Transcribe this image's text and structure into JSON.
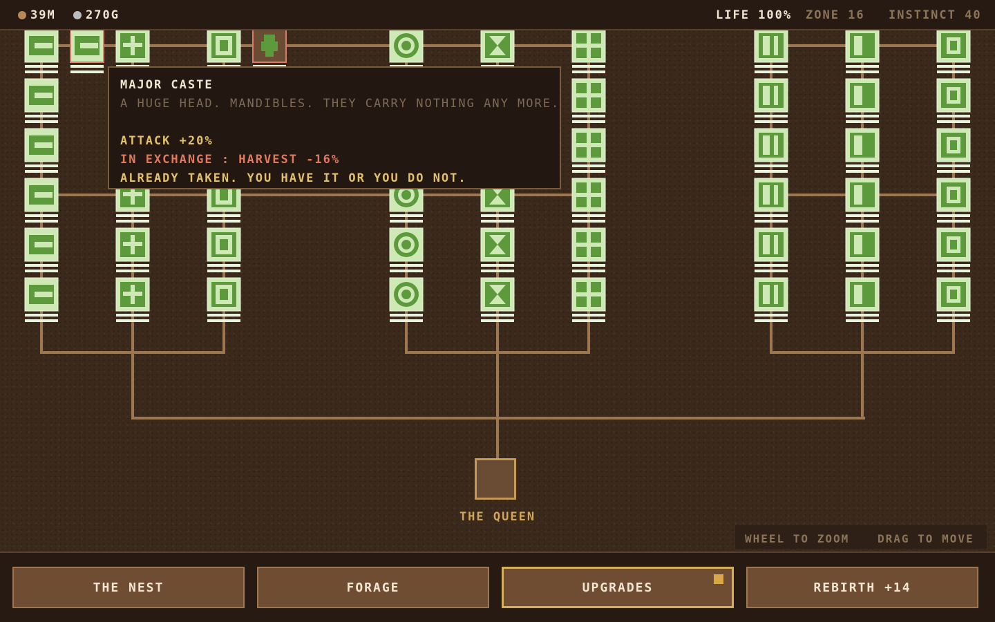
{
  "resources": {
    "copper_amount": "39M",
    "stone_amount": "270G",
    "copper_color": "#b8875a",
    "stone_color": "#bdbdbd"
  },
  "status": {
    "life": "LIFE 100%",
    "zone": "ZONE 16",
    "instinct": "INSTINCT 40"
  },
  "tooltip": {
    "title": "MAJOR CASTE",
    "description": "A HUGE HEAD. MANDIBLES. THEY CARRY NOTHING ANY MORE.",
    "bonus": "ATTACK +20%",
    "penalty": "IN EXCHANGE : HARVEST -16%",
    "note": "ALREADY TAKEN. YOU HAVE IT OR YOU DO NOT."
  },
  "tree": {
    "root_label": "THE QUEEN",
    "branch_icons": [
      "head-icon",
      "cross-icon",
      "shell-icon",
      "ring-icon",
      "hourglass-icon",
      "grid-icon",
      "gate-icon",
      "block-icon",
      "frame-icon"
    ],
    "rows_per_branch": 6,
    "selected_node": {
      "branch": 0,
      "row": 0,
      "col_offset": 1,
      "icon": "ant-icon"
    }
  },
  "hints": {
    "zoom": "WHEEL TO ZOOM",
    "move": "DRAG TO MOVE"
  },
  "nav": {
    "nest": "THE NEST",
    "forage": "FORAGE",
    "upgrades": "UPGRADES",
    "rebirth": "REBIRTH +14",
    "active": "upgrades"
  },
  "colors": {
    "node_fill": "#cfe9b6",
    "node_icon": "#5d9a3c",
    "line": "#9c7752",
    "accent": "#d6ae5c",
    "penalty_text": "#e07a5f",
    "bonus_text": "#e3c06a"
  }
}
